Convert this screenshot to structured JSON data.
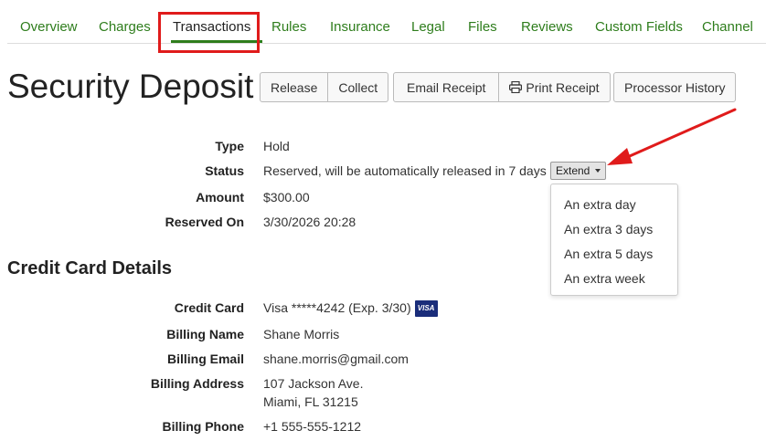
{
  "tabs": [
    {
      "label": "Overview"
    },
    {
      "label": "Charges"
    },
    {
      "label": "Transactions",
      "active": true
    },
    {
      "label": "Rules"
    },
    {
      "label": "Insurance"
    },
    {
      "label": "Legal"
    },
    {
      "label": "Files"
    },
    {
      "label": "Reviews"
    },
    {
      "label": "Custom Fields"
    },
    {
      "label": "Channel"
    }
  ],
  "page_title": "Security Deposit",
  "toolbar": {
    "release_label": "Release",
    "collect_label": "Collect",
    "email_receipt_label": "Email Receipt",
    "print_receipt_label": "Print Receipt",
    "processor_history_label": "Processor History"
  },
  "details": {
    "type_label": "Type",
    "type_value": "Hold",
    "status_label": "Status",
    "status_value": "Reserved, will be automatically released in 7 days",
    "extend_label": "Extend",
    "amount_label": "Amount",
    "amount_value": "$300.00",
    "reserved_on_label": "Reserved On",
    "reserved_on_value": "3/30/2026 20:28"
  },
  "extend_menu": {
    "items": [
      "An extra day",
      "An extra 3 days",
      "An extra 5 days",
      "An extra week"
    ]
  },
  "card_section": {
    "title": "Credit Card Details",
    "credit_card_label": "Credit Card",
    "credit_card_value": "Visa *****4242 (Exp. 3/30)",
    "card_brand": "VISA",
    "billing_name_label": "Billing Name",
    "billing_name_value": "Shane Morris",
    "billing_email_label": "Billing Email",
    "billing_email_value": "shane.morris@gmail.com",
    "billing_address_label": "Billing Address",
    "billing_address_line1": "107 Jackson Ave.",
    "billing_address_line2": "Miami, FL 31215",
    "billing_phone_label": "Billing Phone",
    "billing_phone_value": "+1 555-555-1212"
  },
  "colors": {
    "tab_link": "#2e7d1c",
    "annotation_red": "#e01b1b",
    "visa_blue": "#1a2d7a"
  }
}
